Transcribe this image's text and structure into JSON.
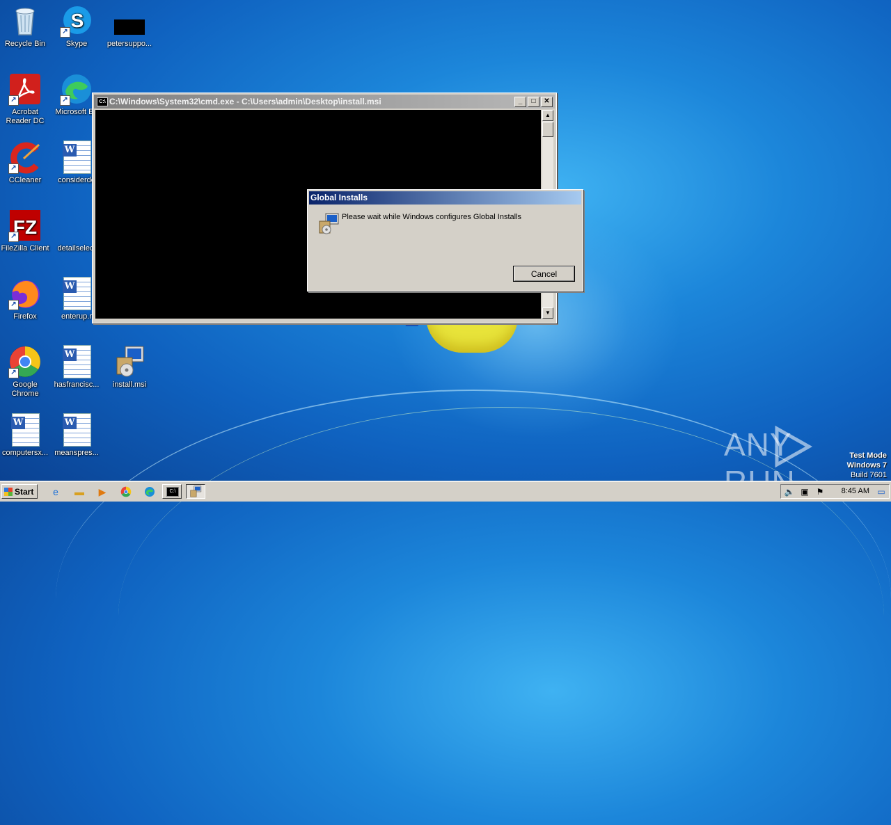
{
  "desktop": {
    "icons": [
      {
        "label": "Recycle Bin"
      },
      {
        "label": "Skype"
      },
      {
        "label": "petersuppo..."
      },
      {
        "label": "Acrobat\nReader DC"
      },
      {
        "label": "Microsoft Ed"
      },
      {
        "label": "CCleaner"
      },
      {
        "label": "considerde"
      },
      {
        "label": "FileZilla Client"
      },
      {
        "label": "detailselect"
      },
      {
        "label": "Firefox"
      },
      {
        "label": "enterup.r"
      },
      {
        "label": "Google\nChrome"
      },
      {
        "label": "hasfrancisc..."
      },
      {
        "label": "install.msi"
      },
      {
        "label": "computersx..."
      },
      {
        "label": "meanspres..."
      }
    ]
  },
  "cmd_window": {
    "title": "C:\\Windows\\System32\\cmd.exe - C:\\Users\\admin\\Desktop\\install.msi",
    "icon_text": "C:\\"
  },
  "installer_dialog": {
    "title": "Global Installs",
    "message": "Please wait while Windows configures Global Installs",
    "cancel_label": "Cancel"
  },
  "watermark": {
    "text_left": "ANY",
    "text_right": "RUN"
  },
  "system_info": {
    "line1": "Test Mode",
    "line2": "Windows 7",
    "line3": "Build 7601"
  },
  "taskbar": {
    "start_label": "Start",
    "clock": "8:45 AM"
  },
  "colors": {
    "dialog_title_start": "#0a246a",
    "dialog_title_end": "#a6caf0",
    "cmd_title_inactive": "#808080",
    "desktop_blue": "#1c86da"
  }
}
